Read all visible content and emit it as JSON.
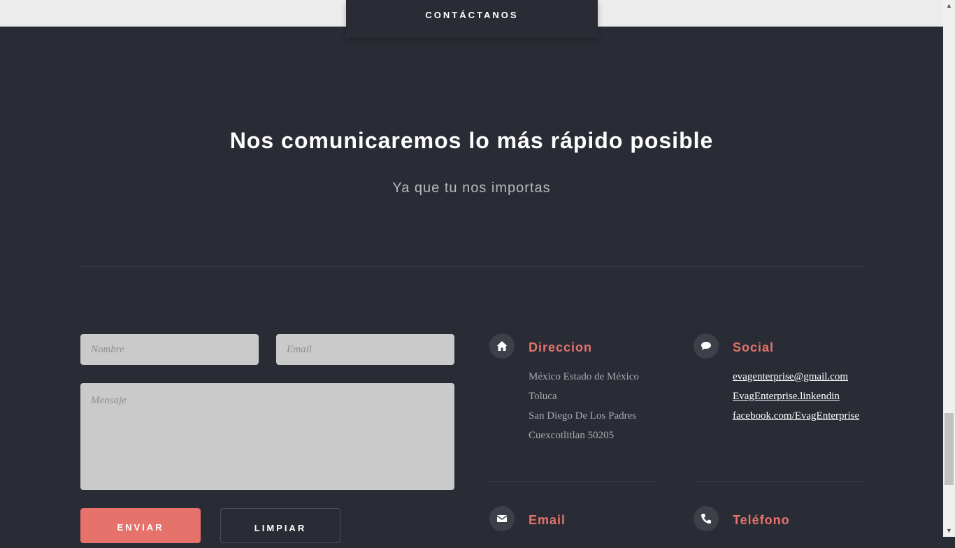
{
  "nav": {
    "tab_label": "CONTÁCTANOS"
  },
  "hero": {
    "title": "Nos comunicaremos lo más rápido posible",
    "subtitle": "Ya que tu nos importas"
  },
  "form": {
    "name_placeholder": "Nombre",
    "email_placeholder": "Email",
    "message_placeholder": "Mensaje",
    "send_label": "ENVIAR",
    "clear_label": "LIMPIAR"
  },
  "address": {
    "title": "Direccion",
    "icon": "home-icon",
    "lines": [
      "México Estado de México",
      "Toluca",
      "San Diego De Los Padres",
      "Cuexcotlitlan 50205"
    ]
  },
  "social": {
    "title": "Social",
    "icon": "comment-icon",
    "links": [
      "evagenterprise@gmail.com",
      "EvagEnterprise.linkendin",
      "facebook.com/EvagEnterprise"
    ]
  },
  "email_section": {
    "title": "Email",
    "icon": "envelope-icon"
  },
  "phone_section": {
    "title": "Teléfono",
    "icon": "phone-icon"
  },
  "colors": {
    "background": "#2a2c35",
    "accent": "#e6726c",
    "field": "#cacaca"
  }
}
